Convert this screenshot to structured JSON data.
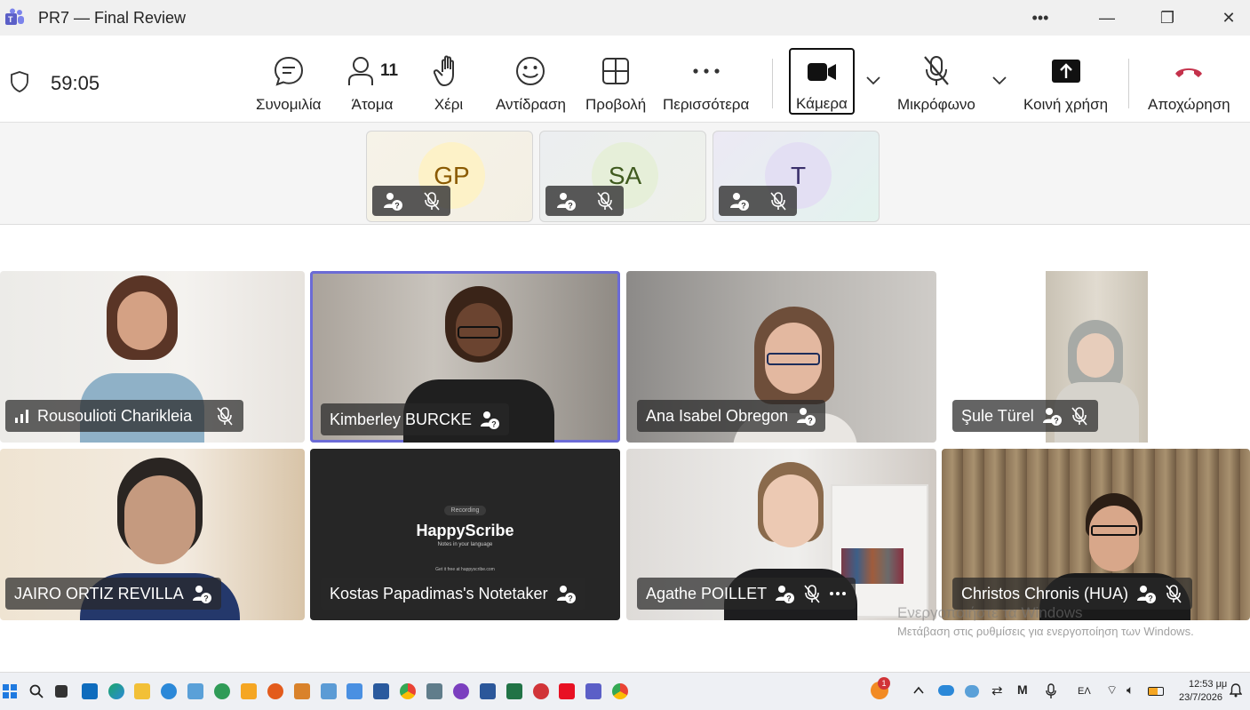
{
  "window": {
    "title": "PR7 — Final Review",
    "more_label": "•••",
    "minimize_label": "—",
    "maximize_label": "❐",
    "close_label": "✕"
  },
  "toolbar": {
    "timer": "59:05",
    "chat_label": "Συνομιλία",
    "people_label": "Άτομα",
    "people_count": "11",
    "raise_hand_label": "Χέρι",
    "react_label": "Αντίδραση",
    "view_label": "Προβολή",
    "more_label": "Περισσότερα",
    "camera_label": "Κάμερα",
    "mic_label": "Μικρόφωνο",
    "share_label": "Κοινή χρήση",
    "leave_label": "Αποχώρηση"
  },
  "avatars": [
    {
      "initials": "GP",
      "bg": "#fdf2c8",
      "fg": "#8a5a00"
    },
    {
      "initials": "SA",
      "bg": "#e6efd9",
      "fg": "#3f5a1e"
    },
    {
      "initials": "T",
      "bg": "#e3dff3",
      "fg": "#3a2f6b"
    }
  ],
  "participants": [
    {
      "name": "Rousoulioti Charikleia"
    },
    {
      "name": "Kimberley BURCKE"
    },
    {
      "name": "Ana Isabel Obregon"
    },
    {
      "name": "Şule Türel"
    },
    {
      "name": "JAIRO ORTIZ REVILLA"
    },
    {
      "name": "Kostas Papadimas's Notetaker"
    },
    {
      "name": "Agathe POILLET"
    },
    {
      "name": "Christos Chronis (HUA)"
    }
  ],
  "notetaker_screen": {
    "recording_label": "Recording",
    "brand": "HappyScribe",
    "tagline": "Notes in your language",
    "footer": "Get it free at happyscribe.com"
  },
  "watermark": {
    "line1": "Ενεργοποιήστε τα Windows",
    "line2": "Μετάβαση στις ρυθμίσεις για ενεργοποίηση των Windows."
  },
  "taskbar": {
    "language": "ΕΛ",
    "time": "12:53 μμ",
    "date": "23/7/2026",
    "notification_count": "1"
  },
  "colors": {
    "accent": "#6b6bd6",
    "leave_red": "#c4314b"
  }
}
